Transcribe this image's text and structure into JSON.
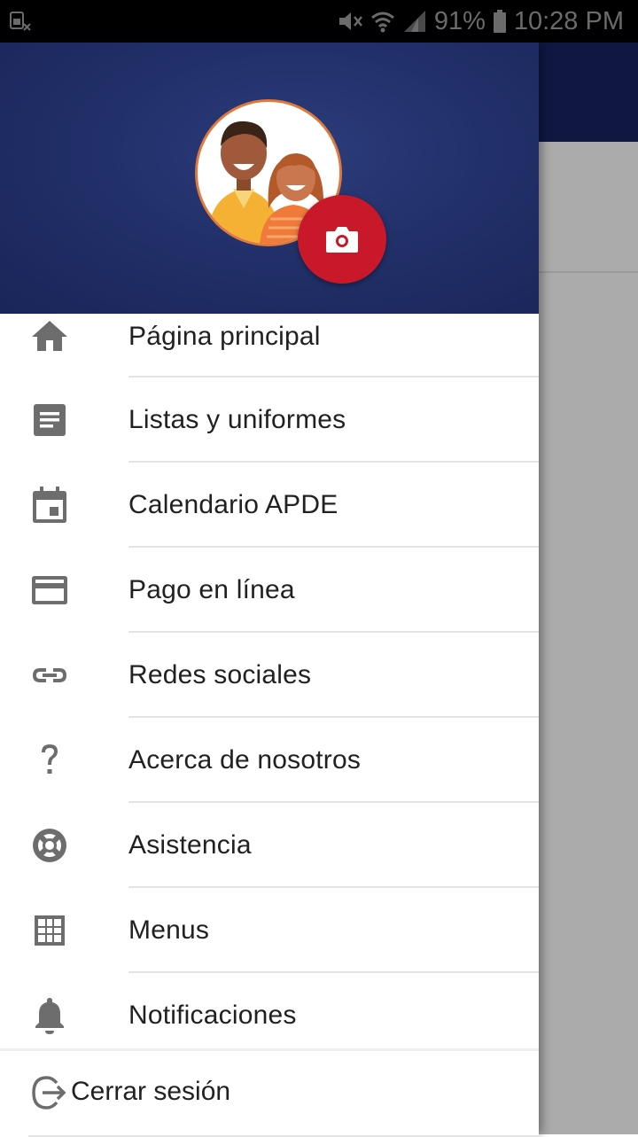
{
  "status_bar": {
    "battery": "91%",
    "time": "10:28 PM",
    "icons": [
      "sim-card-x-icon",
      "mute-icon",
      "wifi-icon",
      "cell-signal-icon",
      "battery-icon"
    ]
  },
  "drawer": {
    "header": {
      "avatar": "family-avatar",
      "camera_button_icon": "camera-icon",
      "colors": {
        "background": "#22306a",
        "avatar_border": "#e07a3c",
        "camera_button": "#c8182a"
      }
    },
    "items": [
      {
        "label": "Página principal",
        "icon": "home-icon"
      },
      {
        "label": "Listas y uniformes",
        "icon": "document-icon"
      },
      {
        "label": "Calendario APDE",
        "icon": "calendar-icon"
      },
      {
        "label": "Pago en línea",
        "icon": "credit-card-icon"
      },
      {
        "label": "Redes sociales",
        "icon": "link-icon"
      },
      {
        "label": "Acerca de nosotros",
        "icon": "help-icon"
      },
      {
        "label": "Asistencia",
        "icon": "lifebuoy-icon"
      },
      {
        "label": "Menus",
        "icon": "grid-icon"
      },
      {
        "label": "Notificaciones",
        "icon": "bell-icon"
      }
    ],
    "footer": {
      "label": "Cerrar sesión",
      "icon": "logout-icon"
    }
  }
}
